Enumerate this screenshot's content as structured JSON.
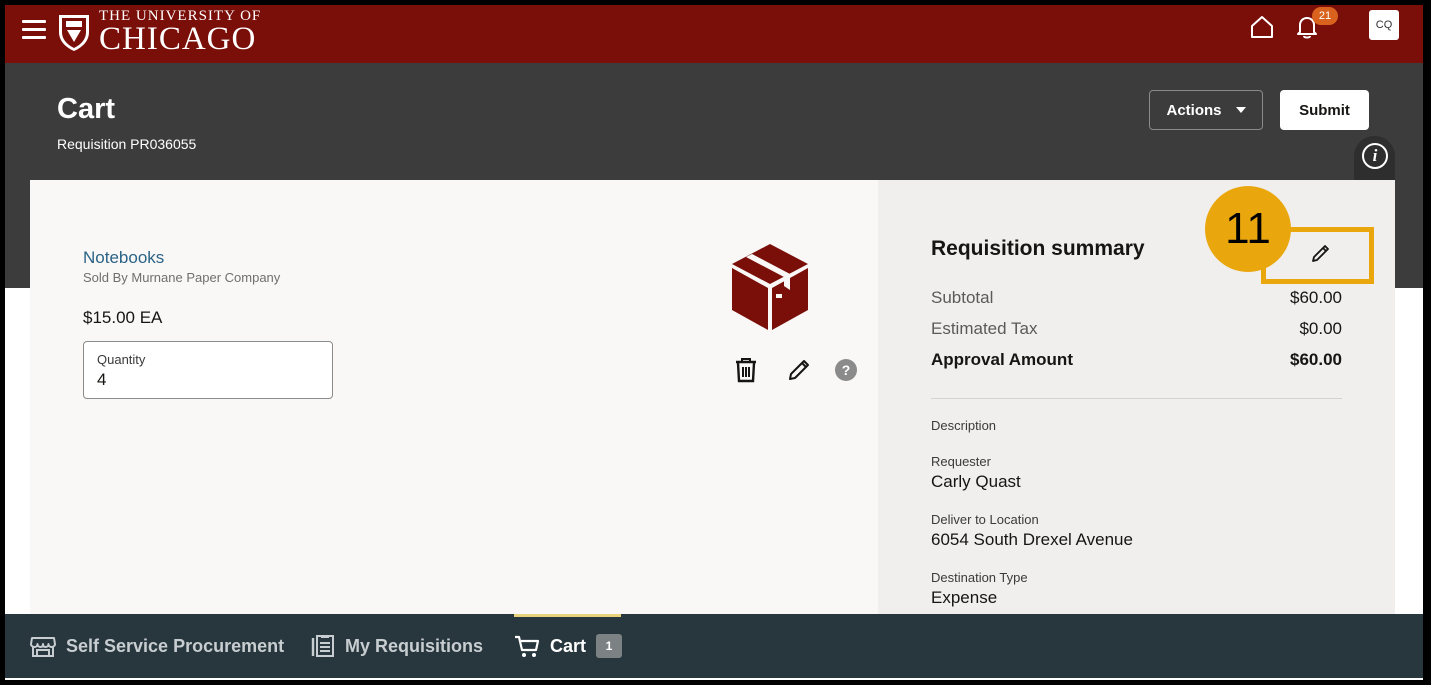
{
  "topbar": {
    "logo_line1": "THE UNIVERSITY OF",
    "logo_line2": "CHICAGO",
    "notifications_count": "21",
    "avatar_initials": "CQ"
  },
  "header": {
    "title": "Cart",
    "subtitle": "Requisition PR036055",
    "actions_label": "Actions",
    "submit_label": "Submit"
  },
  "item": {
    "name": "Notebooks",
    "seller": "Sold By Murnane Paper Company",
    "price": "$15.00 EA",
    "quantity_label": "Quantity",
    "quantity_value": "4",
    "help_glyph": "?"
  },
  "summary": {
    "title": "Requisition summary",
    "subtotal_label": "Subtotal",
    "subtotal_value": "$60.00",
    "tax_label": "Estimated Tax",
    "tax_value": "$0.00",
    "approval_label": "Approval Amount",
    "approval_value": "$60.00",
    "description_label": "Description",
    "requester_label": "Requester",
    "requester_value": "Carly Quast",
    "deliver_label": "Deliver to Location",
    "deliver_value": "6054 South Drexel Avenue",
    "destination_label": "Destination Type",
    "destination_value": "Expense"
  },
  "callout": {
    "number": "11"
  },
  "bottom_nav": {
    "self_service": "Self Service Procurement",
    "my_requisitions": "My Requisitions",
    "cart": "Cart",
    "cart_count": "1"
  },
  "colors": {
    "brand_maroon": "#7a0f0a",
    "header_gray": "#3c3c3c",
    "callout_gold": "#e9a60d",
    "nav_dark": "#28373d",
    "link_blue": "#2b6387"
  },
  "icons": [
    "hamburger-icon",
    "university-shield-icon",
    "home-icon",
    "bell-icon",
    "info-icon",
    "grid-icon",
    "box-icon",
    "trash-icon",
    "pencil-icon",
    "help-icon",
    "store-icon",
    "requisitions-icon",
    "cart-icon"
  ]
}
